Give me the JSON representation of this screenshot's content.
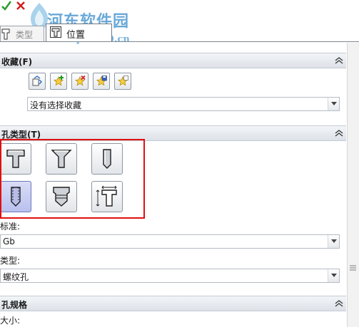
{
  "header": {
    "watermark_title": "河东软件园",
    "watermark_url": "www.pc0359.cn",
    "tabs": [
      {
        "label": "类型",
        "icon": "hole-type-icon",
        "active": false
      },
      {
        "label": "位置",
        "icon": "hole-position-icon",
        "active": true
      }
    ]
  },
  "favorites": {
    "title": "收藏(F)",
    "buttons": [
      {
        "icon": "apply-default-icon"
      },
      {
        "icon": "add-favorite-icon"
      },
      {
        "icon": "delete-favorite-icon"
      },
      {
        "icon": "save-favorite-icon"
      },
      {
        "icon": "load-favorite-icon"
      }
    ],
    "selected": "没有选择收藏"
  },
  "hole_type": {
    "title": "孔类型(T)",
    "types": [
      {
        "icon": "counterbore-icon",
        "selected": false
      },
      {
        "icon": "countersink-icon",
        "selected": false
      },
      {
        "icon": "simple-hole-icon",
        "selected": false
      },
      {
        "icon": "tapped-hole-icon",
        "selected": true
      },
      {
        "icon": "pipe-tap-icon",
        "selected": false
      },
      {
        "icon": "legacy-hole-icon",
        "selected": false
      }
    ],
    "standard_label": "标准:",
    "standard_value": "Gb",
    "type_label": "类型:",
    "type_value": "螺纹孔"
  },
  "hole_spec": {
    "title": "孔规格",
    "size_label": "大小:"
  },
  "colors": {
    "highlight_box": "#e01010",
    "selected_fill": "#c4caf2",
    "watermark": "#6aa9d8"
  }
}
